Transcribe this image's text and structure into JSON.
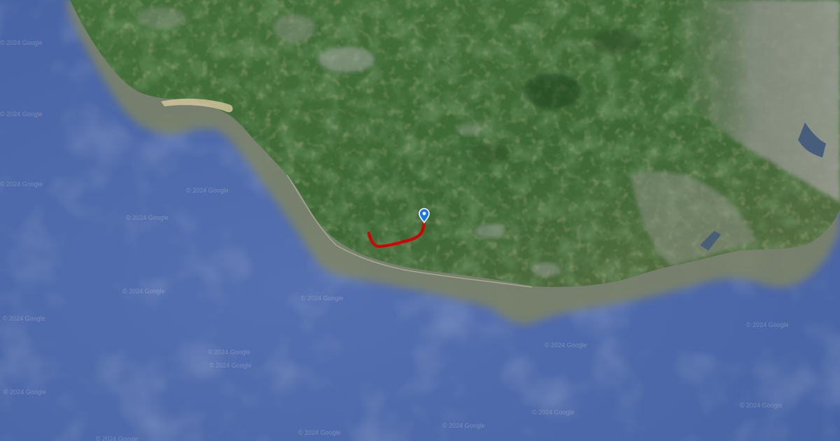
{
  "map": {
    "type": "satellite",
    "watermark_text": "© 2024 Google",
    "colors": {
      "sea": "#4a69a8",
      "sea_shallow": "#8a8a6a",
      "land": "#3f6a38",
      "urban": "#8c9188",
      "route": "#d40000",
      "marker": "#1a73e8"
    },
    "route": {
      "name": "",
      "color": "#d40000"
    },
    "marker": {
      "icon": "location-pin-icon"
    }
  }
}
